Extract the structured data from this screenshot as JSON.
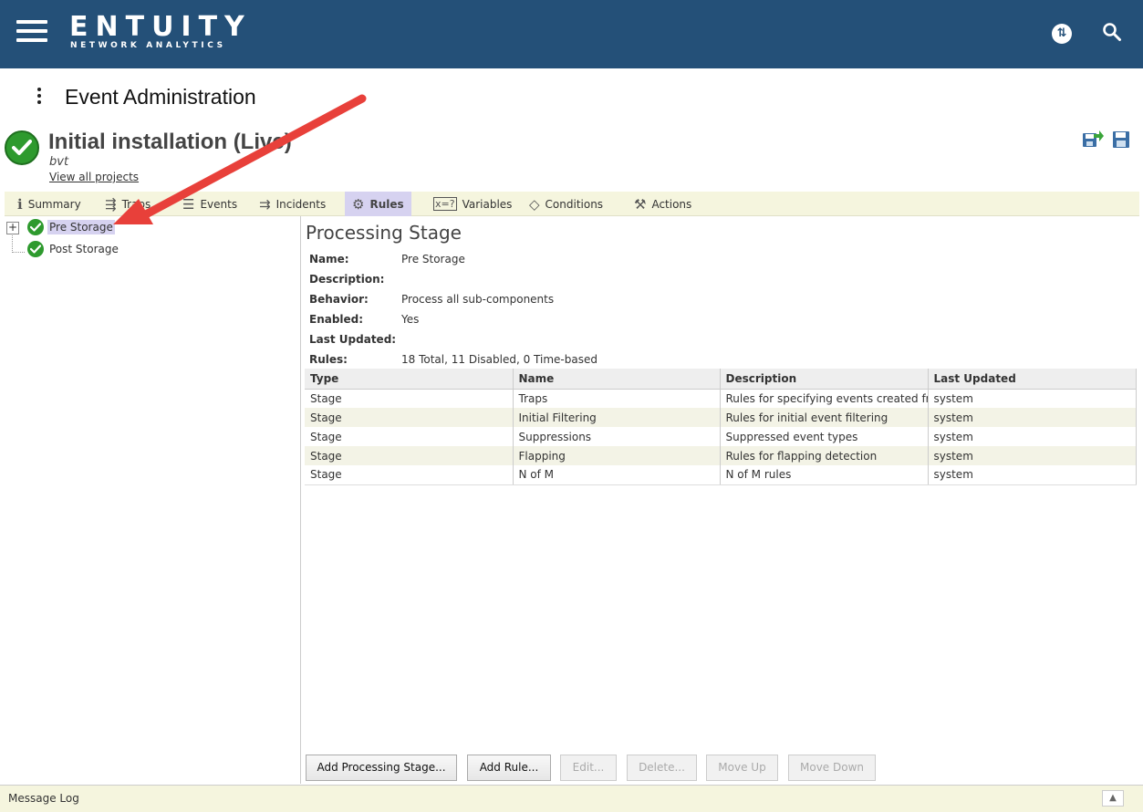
{
  "header": {
    "logo_main": "ENTUITY",
    "logo_sub": "NETWORK ANALYTICS",
    "brand_color": "#245078",
    "icons": [
      "menu-icon",
      "sync-icon",
      "search-icon"
    ]
  },
  "page": {
    "title": "Event Administration"
  },
  "project": {
    "title": "Initial installation (Live)",
    "subtitle": "bvt",
    "link": "View all projects"
  },
  "tabs": [
    {
      "label": "Summary",
      "icon": "info-icon"
    },
    {
      "label": "Traps",
      "icon": "traps-icon"
    },
    {
      "label": "Events",
      "icon": "events-icon"
    },
    {
      "label": "Incidents",
      "icon": "incidents-icon"
    },
    {
      "label": "Rules",
      "icon": "gears-icon",
      "active": true
    },
    {
      "label": "Variables",
      "icon": "variables-icon"
    },
    {
      "label": "Conditions",
      "icon": "conditions-icon"
    },
    {
      "label": "Actions",
      "icon": "actions-icon"
    }
  ],
  "tree": {
    "items": [
      {
        "label": "Pre Storage",
        "selected": true
      },
      {
        "label": "Post Storage"
      }
    ]
  },
  "panel": {
    "title": "Processing Stage",
    "props": {
      "name_label": "Name:",
      "name_value": "Pre Storage",
      "description_label": "Description:",
      "description_value": "",
      "behavior_label": "Behavior:",
      "behavior_value": "Process all sub-components",
      "enabled_label": "Enabled:",
      "enabled_value": "Yes",
      "last_updated_label": "Last Updated:",
      "last_updated_value": "",
      "rules_label": "Rules:",
      "rules_value": "18 Total, 11 Disabled, 0 Time-based"
    },
    "table": {
      "columns": [
        "Type",
        "Name",
        "Description",
        "Last Updated"
      ],
      "rows": [
        [
          "Stage",
          "Traps",
          "Rules for specifying events created fr",
          "system"
        ],
        [
          "Stage",
          "Initial Filtering",
          "Rules for initial event filtering",
          "system"
        ],
        [
          "Stage",
          "Suppressions",
          "Suppressed event types",
          "system"
        ],
        [
          "Stage",
          "Flapping",
          "Rules for flapping detection",
          "system"
        ],
        [
          "Stage",
          "N of M",
          "N of M rules",
          "system"
        ]
      ]
    }
  },
  "buttons": {
    "add_stage": "Add Processing Stage...",
    "add_rule": "Add Rule...",
    "edit": "Edit...",
    "delete": "Delete...",
    "move_up": "Move Up",
    "move_down": "Move Down"
  },
  "footer": {
    "message_log": "Message Log"
  },
  "colors": {
    "selection": "#d6d2f0",
    "tabbar": "#f5f5de",
    "status_ok": "#2e9a2e",
    "annotation_arrow": "#e8403a"
  }
}
